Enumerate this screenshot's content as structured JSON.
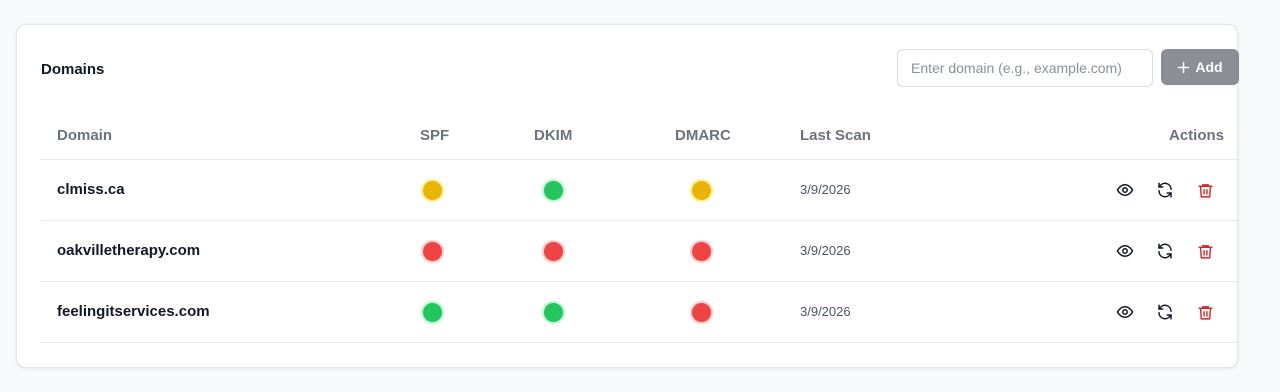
{
  "panel": {
    "title": "Domains",
    "input_placeholder": "Enter domain (e.g., example.com)",
    "input_value": "",
    "add_label": "Add"
  },
  "table": {
    "headers": {
      "domain": "Domain",
      "spf": "SPF",
      "dkim": "DKIM",
      "dmarc": "DMARC",
      "last_scan": "Last Scan",
      "actions": "Actions"
    },
    "rows": [
      {
        "domain": "clmiss.ca",
        "spf": "yellow",
        "dkim": "green",
        "dmarc": "yellow",
        "last_scan": "3/9/2026"
      },
      {
        "domain": "oakvilletherapy.com",
        "spf": "red",
        "dkim": "red",
        "dmarc": "red",
        "last_scan": "3/9/2026"
      },
      {
        "domain": "feelingitservices.com",
        "spf": "green",
        "dkim": "green",
        "dmarc": "red",
        "last_scan": "3/9/2026"
      }
    ],
    "row_actions": [
      "eye-icon",
      "refresh-icon",
      "trash-icon"
    ]
  },
  "colors": {
    "status_green": "#22c55e",
    "status_yellow": "#eab308",
    "status_red": "#ef4444",
    "add_button": "#8b8e95",
    "delete_icon": "#dc2626"
  }
}
